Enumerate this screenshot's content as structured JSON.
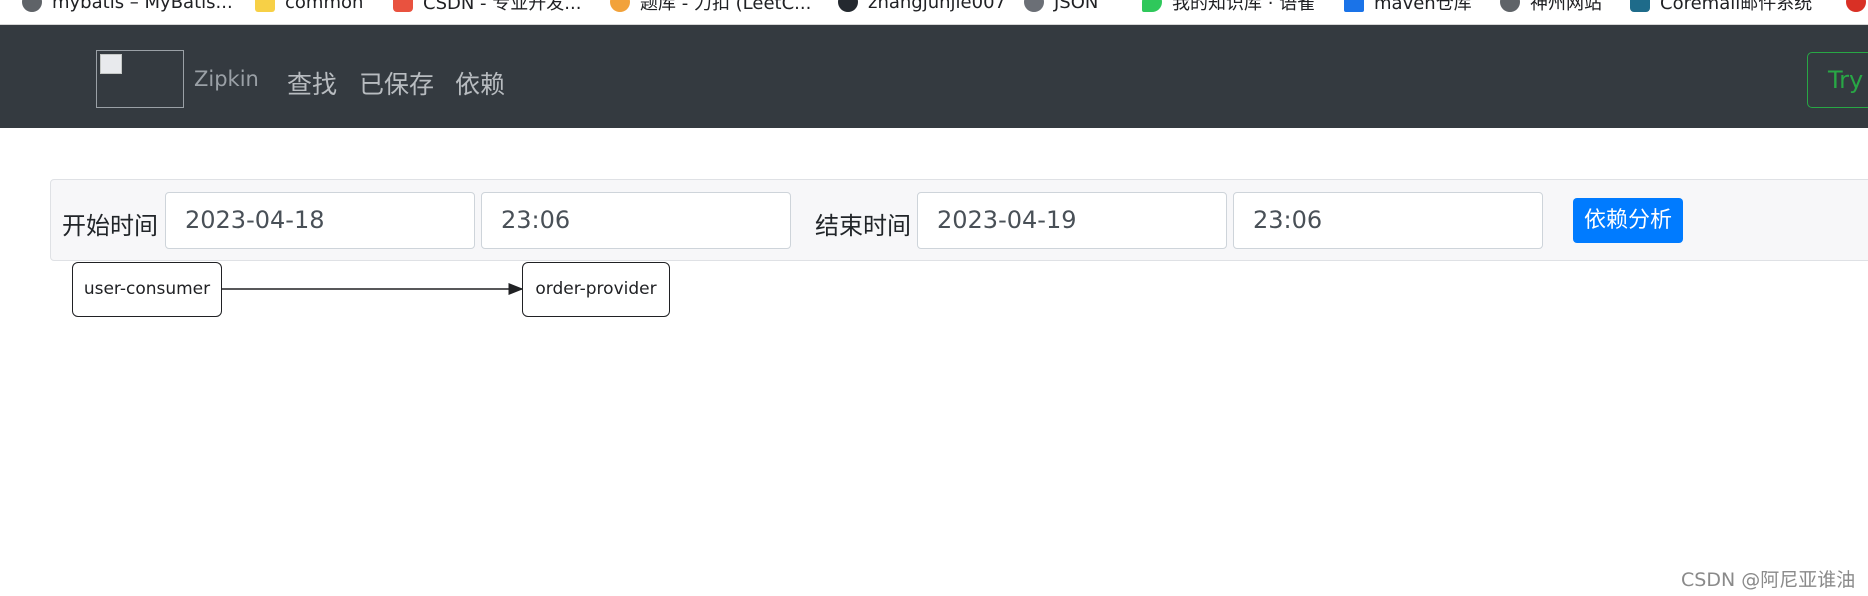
{
  "bookmarks": [
    {
      "label": "mybatis – MyBatis...",
      "icon": "globe-icon"
    },
    {
      "label": "common",
      "icon": "folder-icon"
    },
    {
      "label": "CSDN - 专业开发...",
      "icon": "csdn-icon"
    },
    {
      "label": "题库 - 力扣 (LeetC...",
      "icon": "leetcode-icon"
    },
    {
      "label": "zhangjunjie007",
      "icon": "github-icon"
    },
    {
      "label": "JSON",
      "icon": "json-icon"
    },
    {
      "label": "我的知识库 · 语雀",
      "icon": "yuque-icon"
    },
    {
      "label": "maven仓库",
      "icon": "maven-icon"
    },
    {
      "label": "神州网站",
      "icon": "globe-icon"
    },
    {
      "label": "Coremail邮件系统",
      "icon": "coremail-icon"
    }
  ],
  "navbar": {
    "brand": "Zipkin",
    "links": [
      "查找",
      "已保存",
      "依赖"
    ],
    "try_button": "Try Lens UI"
  },
  "filter": {
    "start_label": "开始时间",
    "start_date": "2023-04-18",
    "start_time": "23:06",
    "end_label": "结束时间",
    "end_date": "2023-04-19",
    "end_time": "23:06",
    "analyze_button": "依赖分析"
  },
  "graph": {
    "nodes": [
      "user-consumer",
      "order-provider"
    ],
    "edges": [
      {
        "from": "user-consumer",
        "to": "order-provider"
      }
    ]
  },
  "watermark": "CSDN @阿尼亚谁油"
}
